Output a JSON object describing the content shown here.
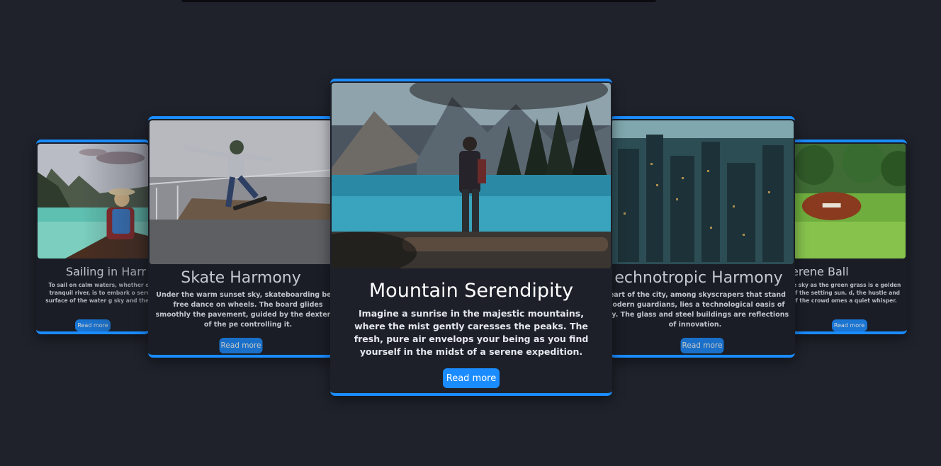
{
  "cards": [
    {
      "title": "Sailing in Harr",
      "text": "To sail on calm waters, whether on along a tranquil river, is to embark o serenity. The surface of the water g sky and the surroundi",
      "button": "Read more"
    },
    {
      "title": "Skate Harmony",
      "text": "Under the warm sunset sky, skateboarding beco free dance on wheels. The board glides smoothly the pavement, guided by the dexterity of the pe controlling it.",
      "button": "Read more"
    },
    {
      "title": "Mountain Serendipity",
      "text": "Imagine a sunrise in the majestic mountains, where the mist gently caresses the peaks. The fresh, pure air envelops your being as you find yourself in the midst of a serene expedition.",
      "button": "Read more"
    },
    {
      "title": "echnotropic Harmony",
      "text": "heart of the city, among skyscrapers that stand modern guardians, lies a technological oasis of nity. The glass and steel buildings are reflections of innovation.",
      "button": "Read more"
    },
    {
      "title": "erene Ball",
      "text": "inting the sky as the green grass is e golden gleams of the setting sun. d, the hustle and bustle of the crowd omes a quiet whisper.",
      "button": "Read more"
    }
  ],
  "colors": {
    "background": "#1f222b",
    "accent": "#1a8cff",
    "card": "#1a1d26"
  }
}
